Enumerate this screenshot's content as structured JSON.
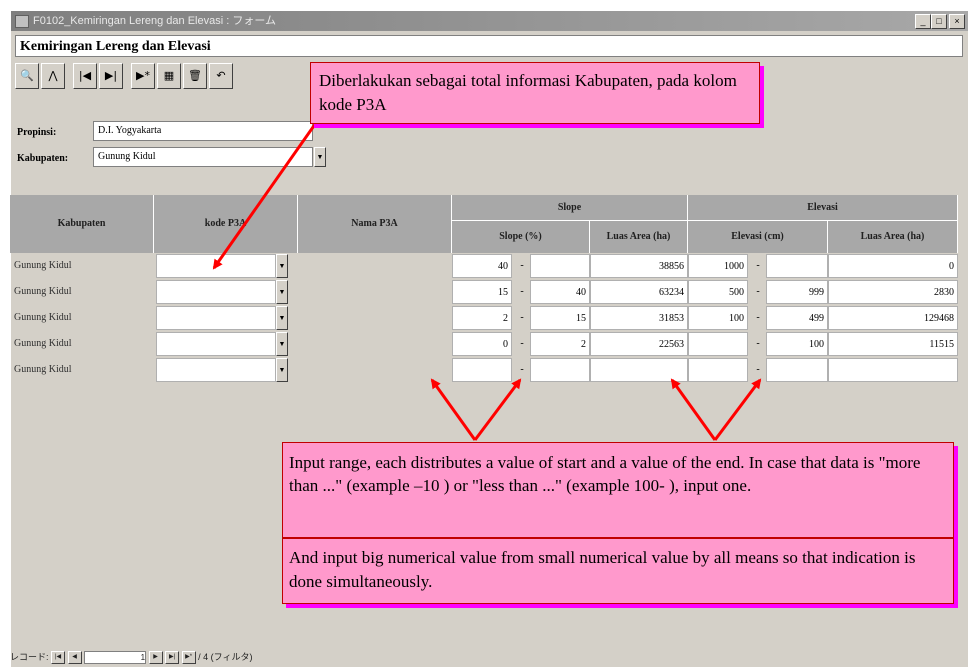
{
  "window": {
    "title": "F0102_Kemiringan Lereng dan Elevasi : フォーム",
    "min_label": "_",
    "max_label": "□",
    "close_label": "×"
  },
  "form": {
    "title": "Kemiringan Lereng dan Elevasi"
  },
  "toolbar": {
    "find_label": "🔍",
    "filter_label": "⋀",
    "first_label": "|◀",
    "last_label": "▶|",
    "next_label": "▶*",
    "save_label": "▦",
    "delete_label": "🗑",
    "undo_label": "↶"
  },
  "filters": {
    "propinsi_label": "Propinsi:",
    "propinsi_value": "D.I. Yogyakarta",
    "kabupaten_label": "Kabupaten:",
    "kabupaten_value": "Gunung Kidul"
  },
  "table": {
    "headers": {
      "kabupaten": "Kabupaten",
      "kode": "kode P3A",
      "nama": "Nama P3A",
      "slope_group": "Slope",
      "elevasi_group": "Elevasi",
      "slope_pct": "Slope (%)",
      "slope_area": "Luas Area (ha)",
      "elev_m": "Elevasi (cm)",
      "elev_area": "Luas Area (ha)"
    },
    "rows": [
      {
        "kab": "Gunung Kidul",
        "s_from": "40",
        "s_to": "",
        "s_area": "38856",
        "e_from": "1000",
        "e_to": "",
        "e_area": "0"
      },
      {
        "kab": "Gunung Kidul",
        "s_from": "15",
        "s_to": "40",
        "s_area": "63234",
        "e_from": "500",
        "e_to": "999",
        "e_area": "2830"
      },
      {
        "kab": "Gunung Kidul",
        "s_from": "2",
        "s_to": "15",
        "s_area": "31853",
        "e_from": "100",
        "e_to": "499",
        "e_area": "129468"
      },
      {
        "kab": "Gunung Kidul",
        "s_from": "0",
        "s_to": "2",
        "s_area": "22563",
        "e_from": "",
        "e_to": "100",
        "e_area": "11515"
      },
      {
        "kab": "Gunung Kidul",
        "s_from": "",
        "s_to": "",
        "s_area": "",
        "e_from": "",
        "e_to": "",
        "e_area": ""
      }
    ],
    "dash": "-"
  },
  "callouts": {
    "top": "Diberlakukan sebagai total informasi Kabupaten, pada kolom kode P3A",
    "range": "Input range, each distributes a value of start and a value of the end. In case that data is \"more than ...\" (example –10 ) or \"less than ...\" (example 100- ), input one.",
    "order": "And input big numerical value from small numerical value by all means so that indication is done simultaneously."
  },
  "navigator": {
    "label": "レコード:",
    "current": "1",
    "total": "/ 4 (フィルタ)"
  },
  "colors": {
    "callout_fill": "#ff99cc",
    "callout_border": "#c00000",
    "arrow": "#ff0000"
  }
}
